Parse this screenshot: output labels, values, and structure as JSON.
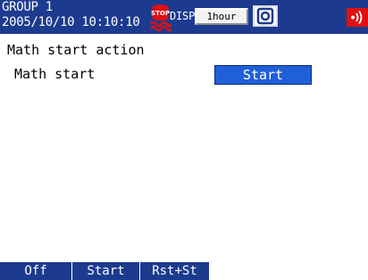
{
  "header": {
    "group_title": "GROUP 1",
    "datetime": "2005/10/10 10:10:10",
    "stop_icon": "stop-icon",
    "disp_label": "DISP",
    "rate_value": "1hour",
    "display_icon": "display-mode-icon",
    "alarm_icon": "alarm-sound-icon"
  },
  "main": {
    "section_title": "Math start action",
    "setting_label": "Math start",
    "setting_value": "Start"
  },
  "softkeys": [
    {
      "label": "Off"
    },
    {
      "label": "Start"
    },
    {
      "label": "Rst+St"
    }
  ],
  "colors": {
    "header_bg": "#1c3b8f",
    "selection_bg": "#1f5fd8",
    "alarm": "#e01010",
    "stop": "#e01010"
  }
}
